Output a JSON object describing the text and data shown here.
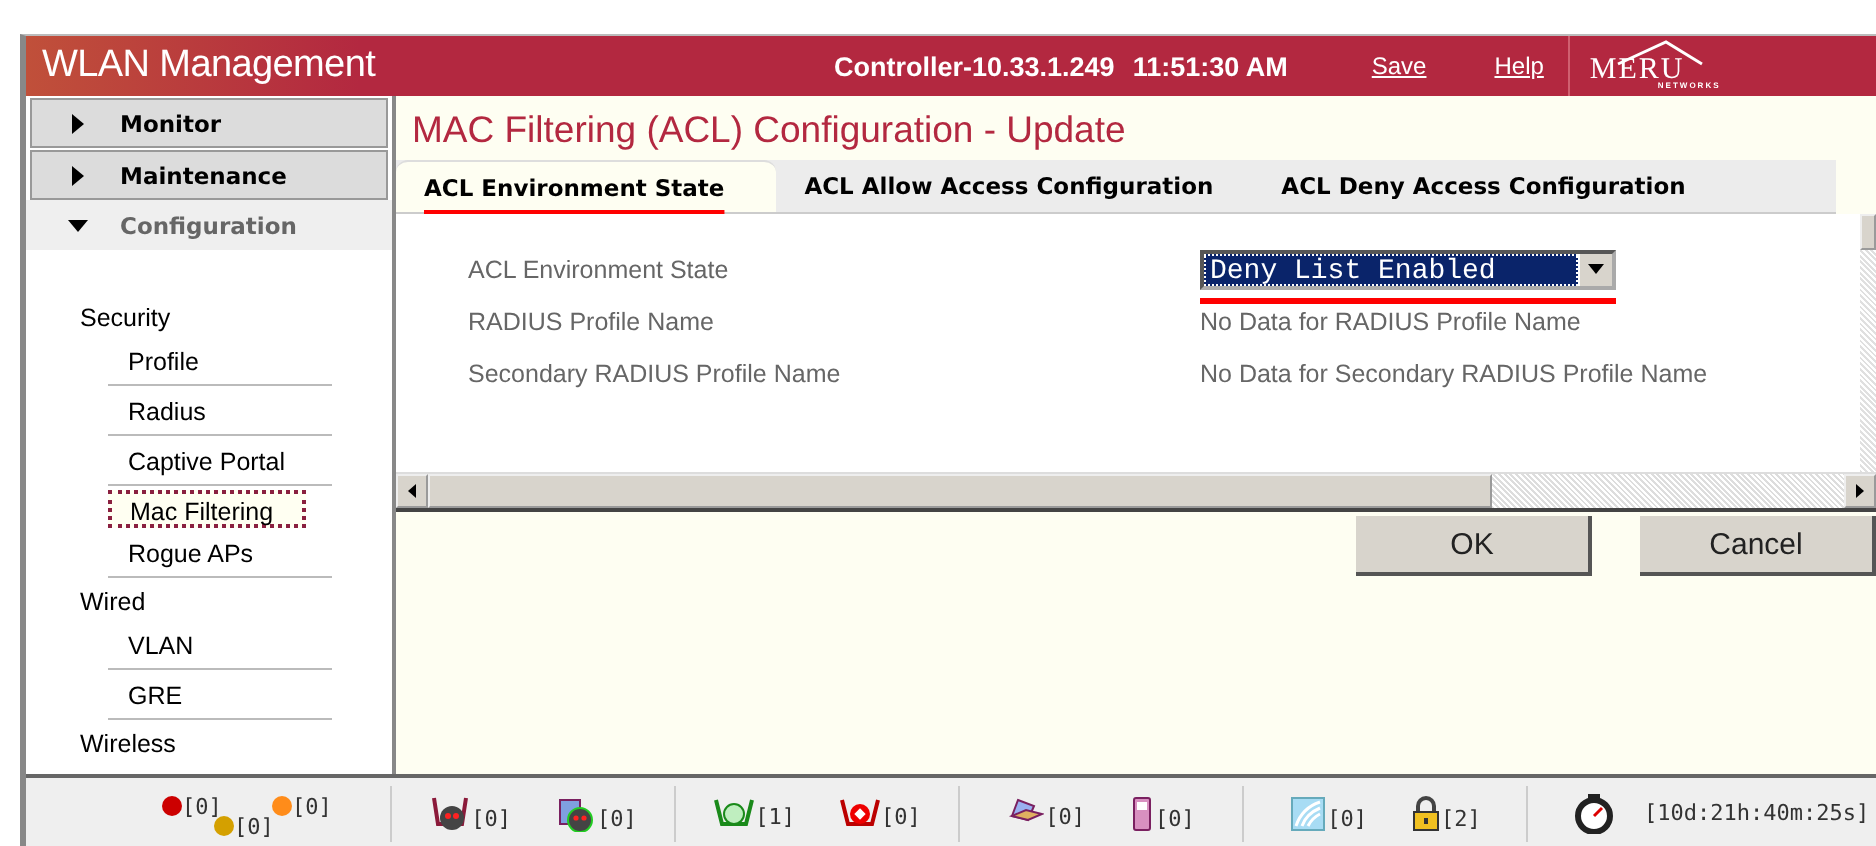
{
  "header": {
    "title": "WLAN Management",
    "controller": "Controller-10.33.1.249",
    "time": "11:51:30 AM",
    "links": [
      "Save",
      "Help"
    ],
    "logo": "MERU",
    "logo_sub": "NETWORKS"
  },
  "sidebar": {
    "sections": [
      {
        "label": "Monitor",
        "expanded": false
      },
      {
        "label": "Maintenance",
        "expanded": false
      },
      {
        "label": "Configuration",
        "expanded": true
      }
    ],
    "groups": [
      {
        "label": "Security",
        "items": [
          {
            "label": "Profile",
            "selected": false
          },
          {
            "label": "Radius",
            "selected": false
          },
          {
            "label": "Captive Portal",
            "selected": false
          },
          {
            "label": "Mac Filtering",
            "selected": true
          },
          {
            "label": "Rogue APs",
            "selected": false
          }
        ]
      },
      {
        "label": "Wired",
        "items": [
          {
            "label": "VLAN",
            "selected": false
          },
          {
            "label": "GRE",
            "selected": false
          }
        ]
      },
      {
        "label": "Wireless"
      }
    ]
  },
  "page": {
    "title": "MAC Filtering (ACL) Configuration - Update",
    "tabs": [
      {
        "label": "ACL Environment State",
        "selected": true,
        "marked": true
      },
      {
        "label": "ACL Allow Access Configuration",
        "selected": false,
        "marked": false
      },
      {
        "label": "ACL Deny Access Configuration",
        "selected": false,
        "marked": false
      }
    ],
    "fields": [
      {
        "label": "ACL Environment State",
        "kind": "select",
        "value": "Deny List Enabled",
        "marked": true
      },
      {
        "label": "RADIUS Profile Name",
        "kind": "text",
        "value": "No Data for RADIUS Profile Name"
      },
      {
        "label": "Secondary RADIUS Profile Name",
        "kind": "text",
        "value": "No Data for Secondary RADIUS Profile Name"
      }
    ],
    "buttons": [
      "OK",
      "Cancel"
    ]
  },
  "status_bar": {
    "alarms": [
      {
        "count": "[0]",
        "color": "#cc0000"
      },
      {
        "count": "[0]",
        "color": "#ff8c1a"
      },
      {
        "count": "[0]",
        "color": "#d4a000"
      }
    ],
    "groups": [
      [
        {
          "kind": "controller-down",
          "count": "[0]"
        },
        {
          "kind": "ap-down",
          "count": "[0]"
        }
      ],
      [
        {
          "kind": "ap-up",
          "count": "[1]"
        },
        {
          "kind": "ap-alarm",
          "count": "[0]"
        }
      ],
      [
        {
          "kind": "laptop",
          "count": "[0]"
        },
        {
          "kind": "phone",
          "count": "[0]"
        }
      ],
      [
        {
          "kind": "wave",
          "count": "[0]"
        },
        {
          "kind": "lock",
          "count": "[2]"
        }
      ]
    ],
    "uptime": "[10d:21h:40m:25s]"
  }
}
